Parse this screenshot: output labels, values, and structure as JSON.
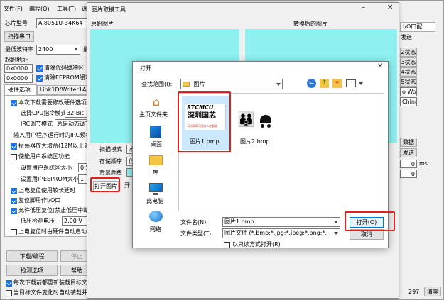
{
  "main": {
    "menu": [
      "文件(F)",
      "编程(O)",
      "工具(T)",
      "调"
    ],
    "chip_label": "芯片型号",
    "chip_value": "AI8051U-34K64",
    "scan_port": "扫描串口",
    "baud_label": "最低波特率",
    "baud_value": "2400",
    "baud_right": "最",
    "start_addr": "起始地址",
    "addr1": "0x0000",
    "clear_code": "清除代码缓冲区",
    "addr2": "0x0000",
    "clear_eeprom": "清除EEPROM缓冲区",
    "tab1": "硬件选项",
    "tab2": "Link1D/Writer1A/U8",
    "opt_this_download": "本次下载需要修改硬件选项",
    "cpu_mode_label": "选择CPU指令模式",
    "cpu_mode_value": "32-Bit",
    "irc_label": "IRC调节模式",
    "irc_value": "总是动态调节",
    "input_freq": "输入用户程序运行时的IRC频率",
    "osc_gain": "振荡器放大增益(12M以上建",
    "user_eeprom_func": "使能用户系统区功能",
    "user_area_size_label": "设置用户系统区大小",
    "user_area_size_value": "0.5",
    "eeprom_size_label": "设置用户EEPROM大小",
    "eeprom_size_value": "1",
    "power_on_delay": "上电复位使用较长延时",
    "reset_pin_io": "复位脚用作I/O口",
    "lvd_reset": "允许低压复位(禁止低压中断",
    "lvd_label": "低压检测电压",
    "lvd_value": "2.00 V",
    "power_erase": "上电复位时由硬件自动启动",
    "download_program": "下载/编程",
    "stop": "停止",
    "check_options": "检测选项",
    "help": "帮助",
    "reload_each": "每次下载前都重新装载目标文",
    "auto_reload": "当目标文件变化时自动装载并",
    "right_tab": "I/O口配",
    "right_send": "发送",
    "right_state1": "2状态",
    "right_state2": "3状态",
    "right_state3": "4状态",
    "right_state4": "5状态",
    "right_world": "o Worl",
    "right_china": "China",
    "right_data": "数据",
    "right_send2": "发送",
    "right_zero1": "0",
    "right_ms": "ms",
    "right_zero2": "0",
    "bottom_num": "297",
    "bottom_clear": "清零"
  },
  "bitmap": {
    "title": "图片取模工具",
    "original_label": "原始图片",
    "converted_label": "转换后的图片",
    "scan_mode_label": "扫描模式",
    "scan_mode_value": "水",
    "store_order_label": "存储顺序",
    "store_order_value": "低",
    "bg_color_label": "背景颜色",
    "open_image": "打开图片",
    "open_right": "开"
  },
  "dialog": {
    "title": "打开",
    "look_in_label": "查找范围(I):",
    "look_in_value": "图片",
    "places": [
      {
        "icon": "star-icon",
        "label": "主页文件夹"
      },
      {
        "icon": "desktop-icon",
        "label": "桌面"
      },
      {
        "icon": "library-icon",
        "label": "库"
      },
      {
        "icon": "computer-icon",
        "label": "此电脑"
      },
      {
        "icon": "network-icon",
        "label": "网络"
      }
    ],
    "files": [
      {
        "name": "图片1.bmp",
        "thumb_title": "STCMCU",
        "thumb_main": "深圳国芯",
        "thumb_sub": "32位8051国芯人工智能"
      },
      {
        "name": "图片2.bmp"
      }
    ],
    "filename_label": "文件名(N):",
    "filename_value": "图片1.bmp",
    "filetype_label": "文件类型(T):",
    "filetype_value": "图片文件 (*.bmp;*.jpg;*.jpeg;*.png;*.",
    "readonly_label": "以只读方式打开(R)",
    "open_button": "打开(O)",
    "cancel_button": "取消",
    "colors": {
      "accent": "#1a73e8",
      "highlight_red": "#e0201c",
      "canvas": "#8ff0f0"
    }
  }
}
